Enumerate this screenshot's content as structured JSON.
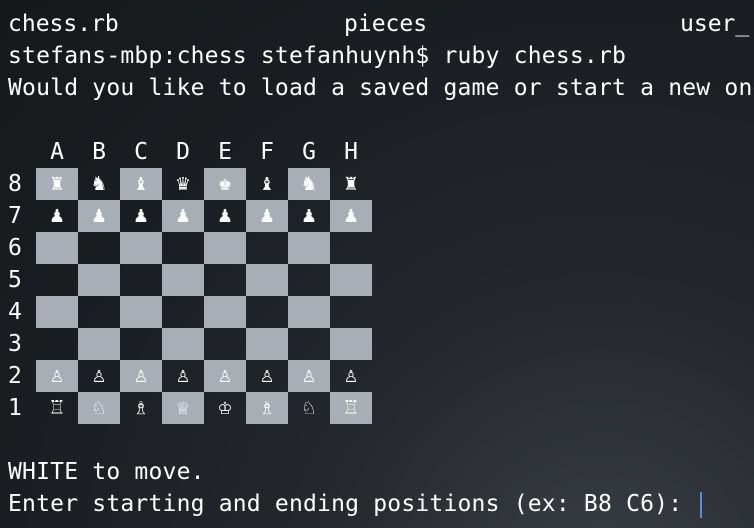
{
  "terminal": {
    "top_cut_line": "                                                  ",
    "files": [
      "chess.rb",
      "pieces",
      "user_"
    ],
    "prompt_line": "stefans-mbp:chess stefanhuynh$ ruby chess.rb",
    "question_line": "Would you like to load a saved game or start a new one",
    "turn_line": "WHITE to move.",
    "input_prompt": "Enter starting and ending positions (ex: B8 C6): "
  },
  "board": {
    "files": [
      "A",
      "B",
      "C",
      "D",
      "E",
      "F",
      "G",
      "H"
    ],
    "ranks": [
      {
        "label": "8",
        "pieces": [
          "♜",
          "♞",
          "♝",
          "♛",
          "♚",
          "♝",
          "♞",
          "♜"
        ]
      },
      {
        "label": "7",
        "pieces": [
          "♟",
          "♟",
          "♟",
          "♟",
          "♟",
          "♟",
          "♟",
          "♟"
        ]
      },
      {
        "label": "6",
        "pieces": [
          "",
          "",
          "",
          "",
          "",
          "",
          "",
          ""
        ]
      },
      {
        "label": "5",
        "pieces": [
          "",
          "",
          "",
          "",
          "",
          "",
          "",
          ""
        ]
      },
      {
        "label": "4",
        "pieces": [
          "",
          "",
          "",
          "",
          "",
          "",
          "",
          ""
        ]
      },
      {
        "label": "3",
        "pieces": [
          "",
          "",
          "",
          "",
          "",
          "",
          "",
          ""
        ]
      },
      {
        "label": "2",
        "pieces": [
          "♙",
          "♙",
          "♙",
          "♙",
          "♙",
          "♙",
          "♙",
          "♙"
        ]
      },
      {
        "label": "1",
        "pieces": [
          "♖",
          "♘",
          "♗",
          "♕",
          "♔",
          "♗",
          "♘",
          "♖"
        ]
      }
    ]
  },
  "colors": {
    "light_square": "#a8aeb6",
    "cursor": "#5a8fd8"
  }
}
